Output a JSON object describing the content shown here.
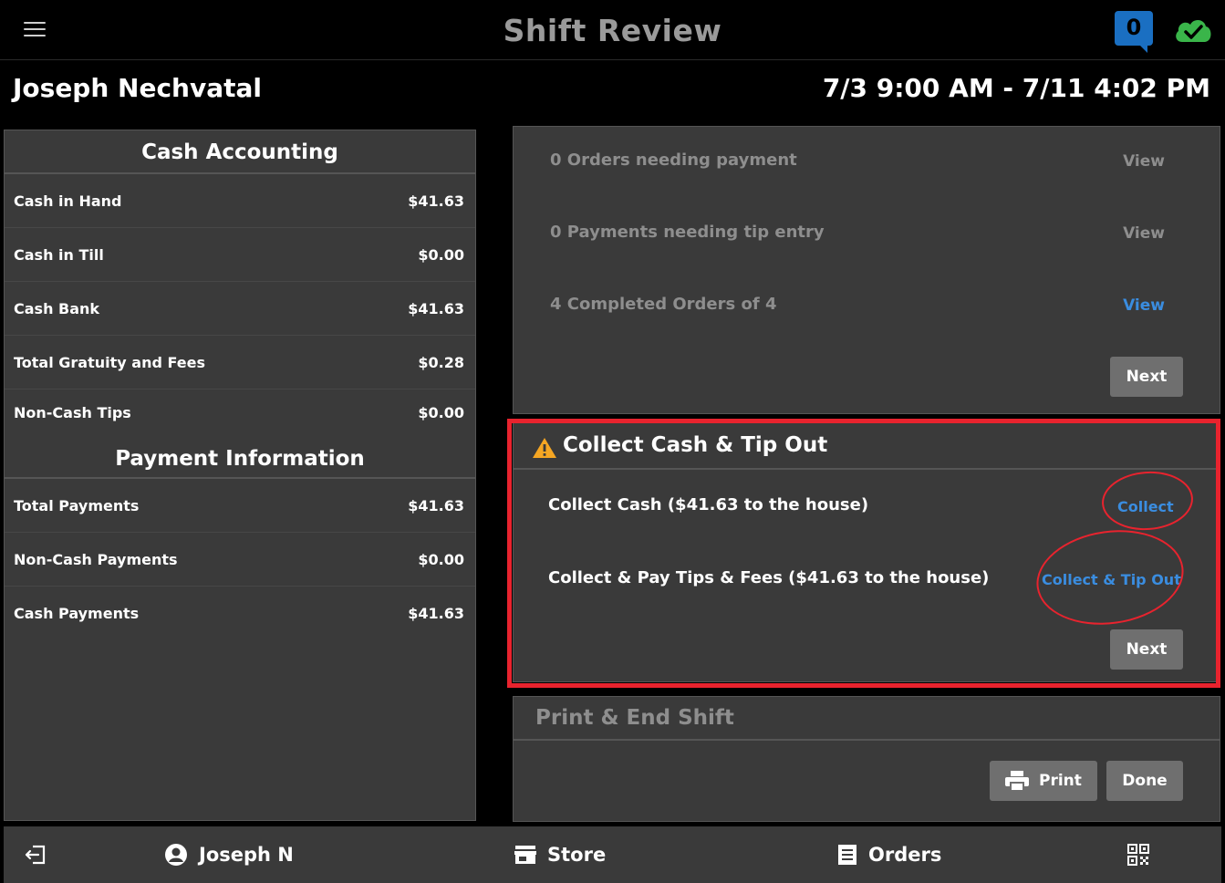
{
  "header": {
    "title": "Shift Review",
    "notification_count": "0",
    "menu_icon": "hamburger-menu-icon",
    "sync_icon": "cloud-check-icon"
  },
  "employee": {
    "name": "Joseph Nechvatal",
    "shift_range": "7/3 9:00 AM - 7/11 4:02 PM"
  },
  "cash_accounting": {
    "title": "Cash Accounting",
    "rows": [
      {
        "label": "Cash in Hand",
        "value": "$41.63"
      },
      {
        "label": "Cash in Till",
        "value": "$0.00"
      },
      {
        "label": "Cash Bank",
        "value": "$41.63"
      },
      {
        "label": "Total Gratuity and Fees",
        "value": "$0.28"
      },
      {
        "label": "Non-Cash Tips",
        "value": "$0.00"
      }
    ]
  },
  "payment_information": {
    "title": "Payment Information",
    "rows": [
      {
        "label": "Total Payments",
        "value": "$41.63"
      },
      {
        "label": "Non-Cash Payments",
        "value": "$0.00"
      },
      {
        "label": "Cash Payments",
        "value": "$41.63"
      }
    ]
  },
  "orders_card": {
    "items": [
      {
        "text": "0 Orders needing payment",
        "link": "View"
      },
      {
        "text": "0 Payments needing tip entry",
        "link": "View"
      },
      {
        "text": "4 Completed Orders of 4",
        "link": "View"
      }
    ],
    "next_label": "Next"
  },
  "collect_card": {
    "title": "Collect Cash & Tip Out",
    "rows": [
      {
        "text": "Collect Cash ($41.63 to the house)",
        "link": "Collect"
      },
      {
        "text": "Collect & Pay Tips & Fees ($41.63 to the house)",
        "link": "Collect & Tip Out"
      }
    ],
    "next_label": "Next"
  },
  "print_card": {
    "title": "Print & End Shift",
    "print_label": "Print",
    "done_label": "Done"
  },
  "bottom_nav": {
    "user_label": "Joseph N",
    "store_label": "Store",
    "orders_label": "Orders"
  },
  "colors": {
    "accent_link": "#3a8de0",
    "highlight": "#e8232e",
    "badge": "#1a6fc2",
    "success": "#3ab54a",
    "warning": "#f5a623"
  }
}
